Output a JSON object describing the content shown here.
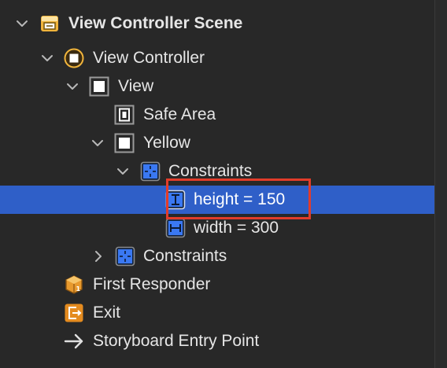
{
  "outline": {
    "rows": [
      {
        "label": "View Controller Scene",
        "icon": "scene-icon",
        "expanded": true
      },
      {
        "label": "View Controller",
        "icon": "view-controller-icon",
        "expanded": true
      },
      {
        "label": "View",
        "icon": "view-icon",
        "expanded": true
      },
      {
        "label": "Safe Area",
        "icon": "safe-area-icon"
      },
      {
        "label": "Yellow",
        "icon": "view-icon",
        "expanded": true
      },
      {
        "label": "Constraints",
        "icon": "constraints-icon",
        "expanded": true
      },
      {
        "label": "height = 150",
        "icon": "height-constraint-icon",
        "selected": true
      },
      {
        "label": "width = 300",
        "icon": "width-constraint-icon"
      },
      {
        "label": "Constraints",
        "icon": "constraints-icon",
        "expanded": false
      },
      {
        "label": "First Responder",
        "icon": "first-responder-icon"
      },
      {
        "label": "Exit",
        "icon": "exit-icon"
      },
      {
        "label": "Storyboard Entry Point",
        "icon": "entry-point-arrow-icon"
      }
    ]
  },
  "colors": {
    "background": "#282828",
    "selection": "#2f5fc8",
    "highlight_border": "#e23c2a",
    "scene_icon": "#f0b43c",
    "constraint_icon": "#3a78f2"
  }
}
